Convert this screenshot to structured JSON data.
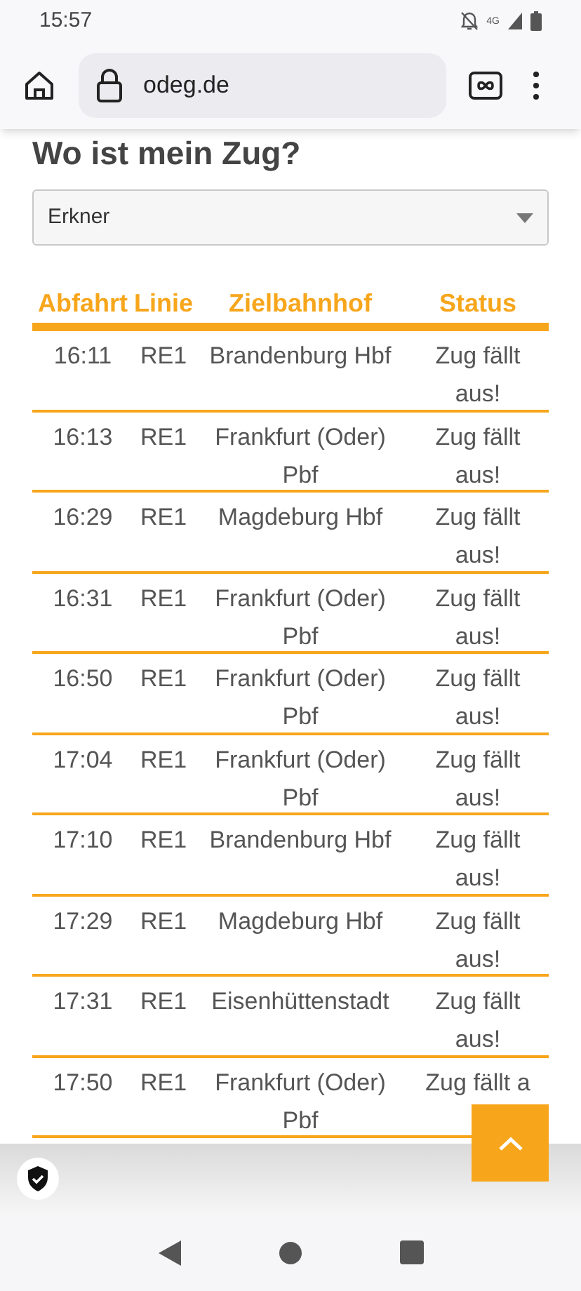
{
  "status_bar": {
    "time": "15:57",
    "network": "4G"
  },
  "browser": {
    "url": "odeg.de"
  },
  "heading": "Wo ist mein Zug?",
  "station_select": {
    "value": "Erkner"
  },
  "table": {
    "columns": [
      "Abfahrt",
      "Linie",
      "Zielbahnhof",
      "Status"
    ],
    "rows": [
      [
        "16:11",
        "RE1",
        "Brandenburg Hbf",
        "Zug fällt aus!"
      ],
      [
        "16:13",
        "RE1",
        "Frankfurt (Oder) Pbf",
        "Zug fällt aus!"
      ],
      [
        "16:29",
        "RE1",
        "Magdeburg Hbf",
        "Zug fällt aus!"
      ],
      [
        "16:31",
        "RE1",
        "Frankfurt (Oder) Pbf",
        "Zug fällt aus!"
      ],
      [
        "16:50",
        "RE1",
        "Frankfurt (Oder) Pbf",
        "Zug fällt aus!"
      ],
      [
        "17:04",
        "RE1",
        "Frankfurt (Oder) Pbf",
        "Zug fällt aus!"
      ],
      [
        "17:10",
        "RE1",
        "Brandenburg Hbf",
        "Zug fällt aus!"
      ],
      [
        "17:29",
        "RE1",
        "Magdeburg Hbf",
        "Zug fällt aus!"
      ],
      [
        "17:31",
        "RE1",
        "Eisenhüttenstadt",
        "Zug fällt aus!"
      ],
      [
        "17:50",
        "RE1",
        "Frankfurt (Oder) Pbf",
        "Zug fällt a"
      ]
    ]
  }
}
